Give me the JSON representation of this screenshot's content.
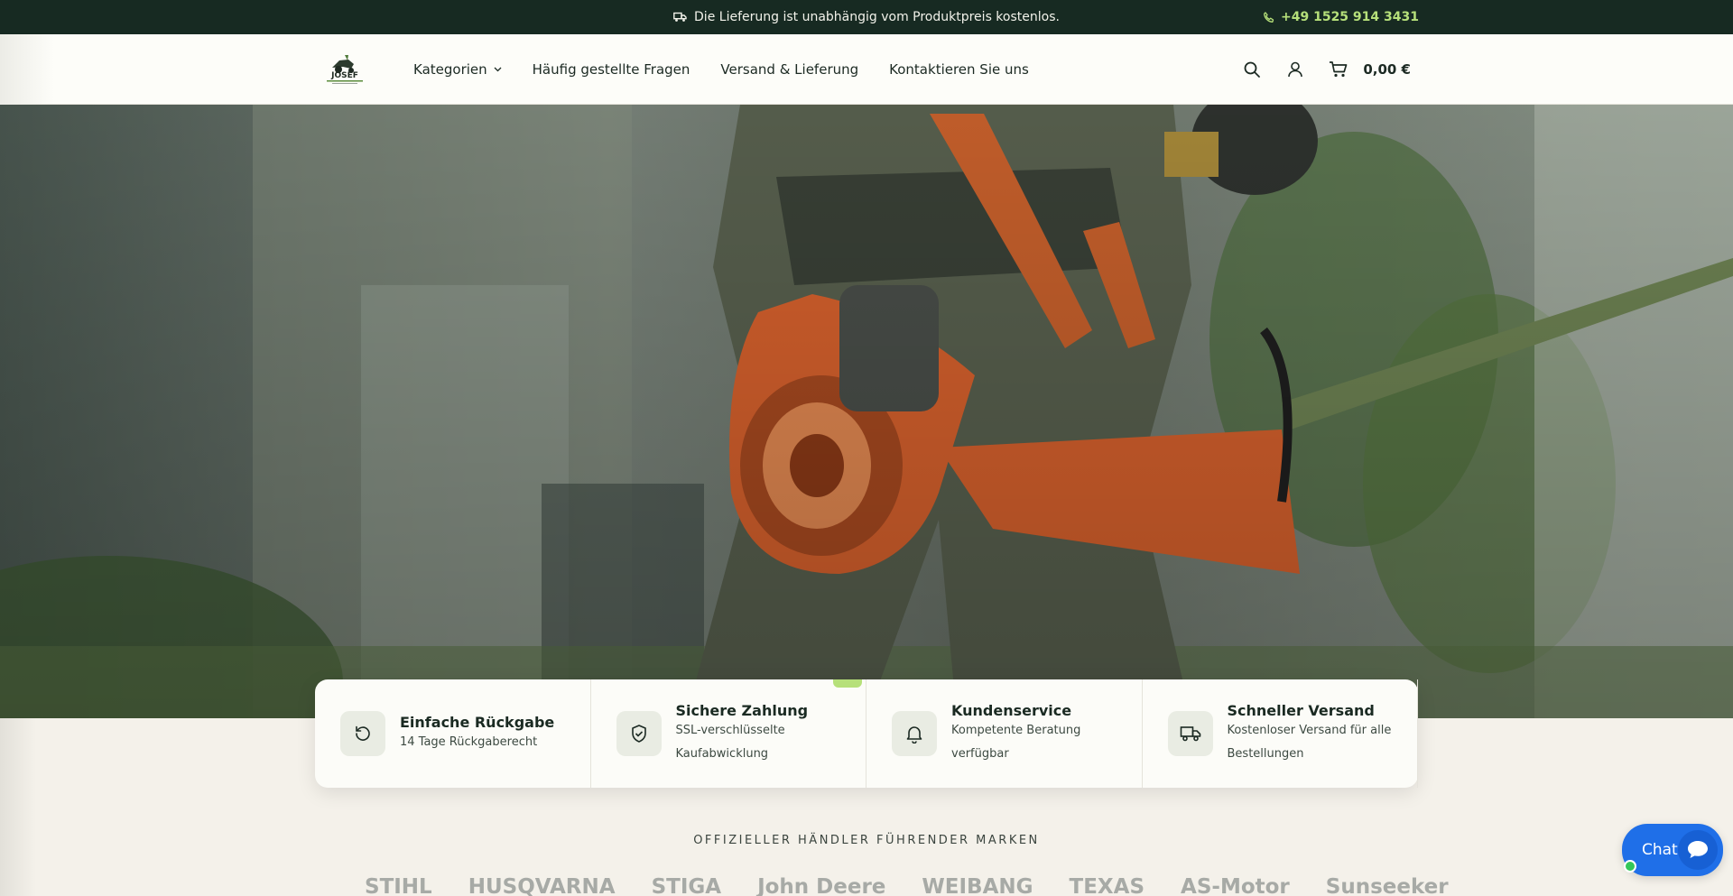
{
  "announcement": {
    "text": "Die Lieferung ist unabhängig vom Produktpreis kostenlos.",
    "icon": "truck-icon",
    "phone": "+49 1525 914 3431",
    "phone_icon": "phone-icon"
  },
  "header": {
    "logo_icon": "josef-logo",
    "nav": [
      {
        "label": "Kategorien",
        "has_dropdown": true
      },
      {
        "label": "Häufig gestellte Fragen"
      },
      {
        "label": "Versand & Lieferung"
      },
      {
        "label": "Kontaktieren Sie uns"
      }
    ],
    "icons": [
      "search-icon",
      "account-icon",
      "cart-icon"
    ],
    "cart_total": "0,00 €"
  },
  "features": [
    {
      "icon": "refresh-icon",
      "title": "Einfache Rückgabe",
      "desc_lines": [
        "14 Tage Rückgaberecht"
      ]
    },
    {
      "icon": "shield-check-icon",
      "title": "Sichere Zahlung",
      "desc_lines": [
        "SSL-verschlüsselte",
        "Kaufabwicklung"
      ]
    },
    {
      "icon": "bell-icon",
      "title": "Kundenservice",
      "desc_lines": [
        "Kompetente Beratung",
        "verfügbar"
      ]
    },
    {
      "icon": "truck-icon",
      "title": "Schneller Versand",
      "desc_lines": [
        "Kostenloser Versand für alle",
        "Bestellungen"
      ]
    }
  ],
  "brands": {
    "title": "OFFIZIELLER HÄNDLER FÜHRENDER MARKEN",
    "items": [
      "STIHL",
      "HUSQVARNA",
      "STIGA",
      "John Deere",
      "WEIBANG",
      "TEXAS",
      "AS-Motor",
      "Sunseeker"
    ]
  },
  "chat": {
    "label": "Chat"
  },
  "colors": {
    "accent": "#b6e07a",
    "dark": "#172a22",
    "chat": "#1f6fe8",
    "hero_orange": "#e0622c"
  }
}
